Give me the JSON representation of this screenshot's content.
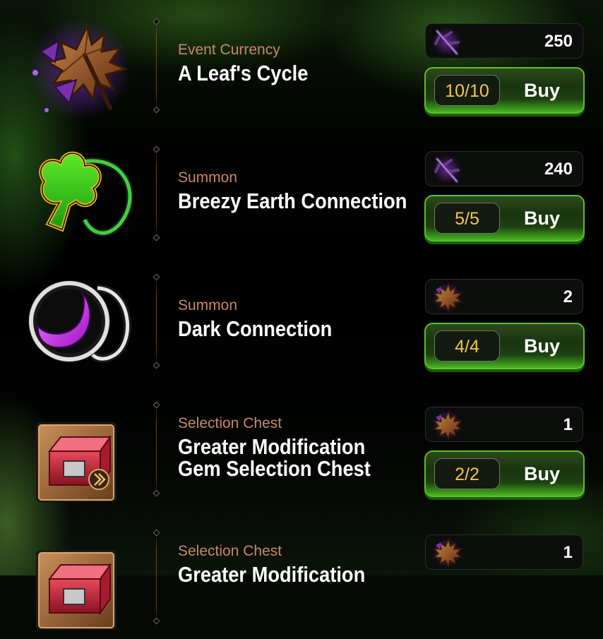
{
  "colors": {
    "category": "#c9896a",
    "name": "#ffffff",
    "count": "#f4c64a",
    "buy_border": "#5fbf2a"
  },
  "items": [
    {
      "category": "Event Currency",
      "name_lines": [
        "A Leaf's Cycle"
      ],
      "icon": "maple-leaf-icon",
      "cost_icon": "branch-icon",
      "cost": "250",
      "purchases": "10/10",
      "buy_label": "Buy"
    },
    {
      "category": "Summon",
      "name_lines": [
        "Breezy Earth Connection"
      ],
      "icon": "clover-pendant-icon",
      "cost_icon": "branch-icon",
      "cost": "240",
      "purchases": "5/5",
      "buy_label": "Buy"
    },
    {
      "category": "Summon",
      "name_lines": [
        "Dark Connection"
      ],
      "icon": "moon-pendant-icon",
      "cost_icon": "maple-leaf-icon",
      "cost": "2",
      "purchases": "4/4",
      "buy_label": "Buy"
    },
    {
      "category": "Selection Chest",
      "name_lines": [
        "Greater Modification",
        "Gem Selection Chest"
      ],
      "icon": "chest-icon",
      "cost_icon": "maple-leaf-icon",
      "cost": "1",
      "purchases": "2/2",
      "buy_label": "Buy"
    },
    {
      "category": "Selection Chest",
      "name_lines": [
        "Greater Modification"
      ],
      "icon": "chest-icon",
      "cost_icon": "maple-leaf-icon",
      "cost": "1",
      "purchases": "",
      "buy_label": ""
    }
  ]
}
